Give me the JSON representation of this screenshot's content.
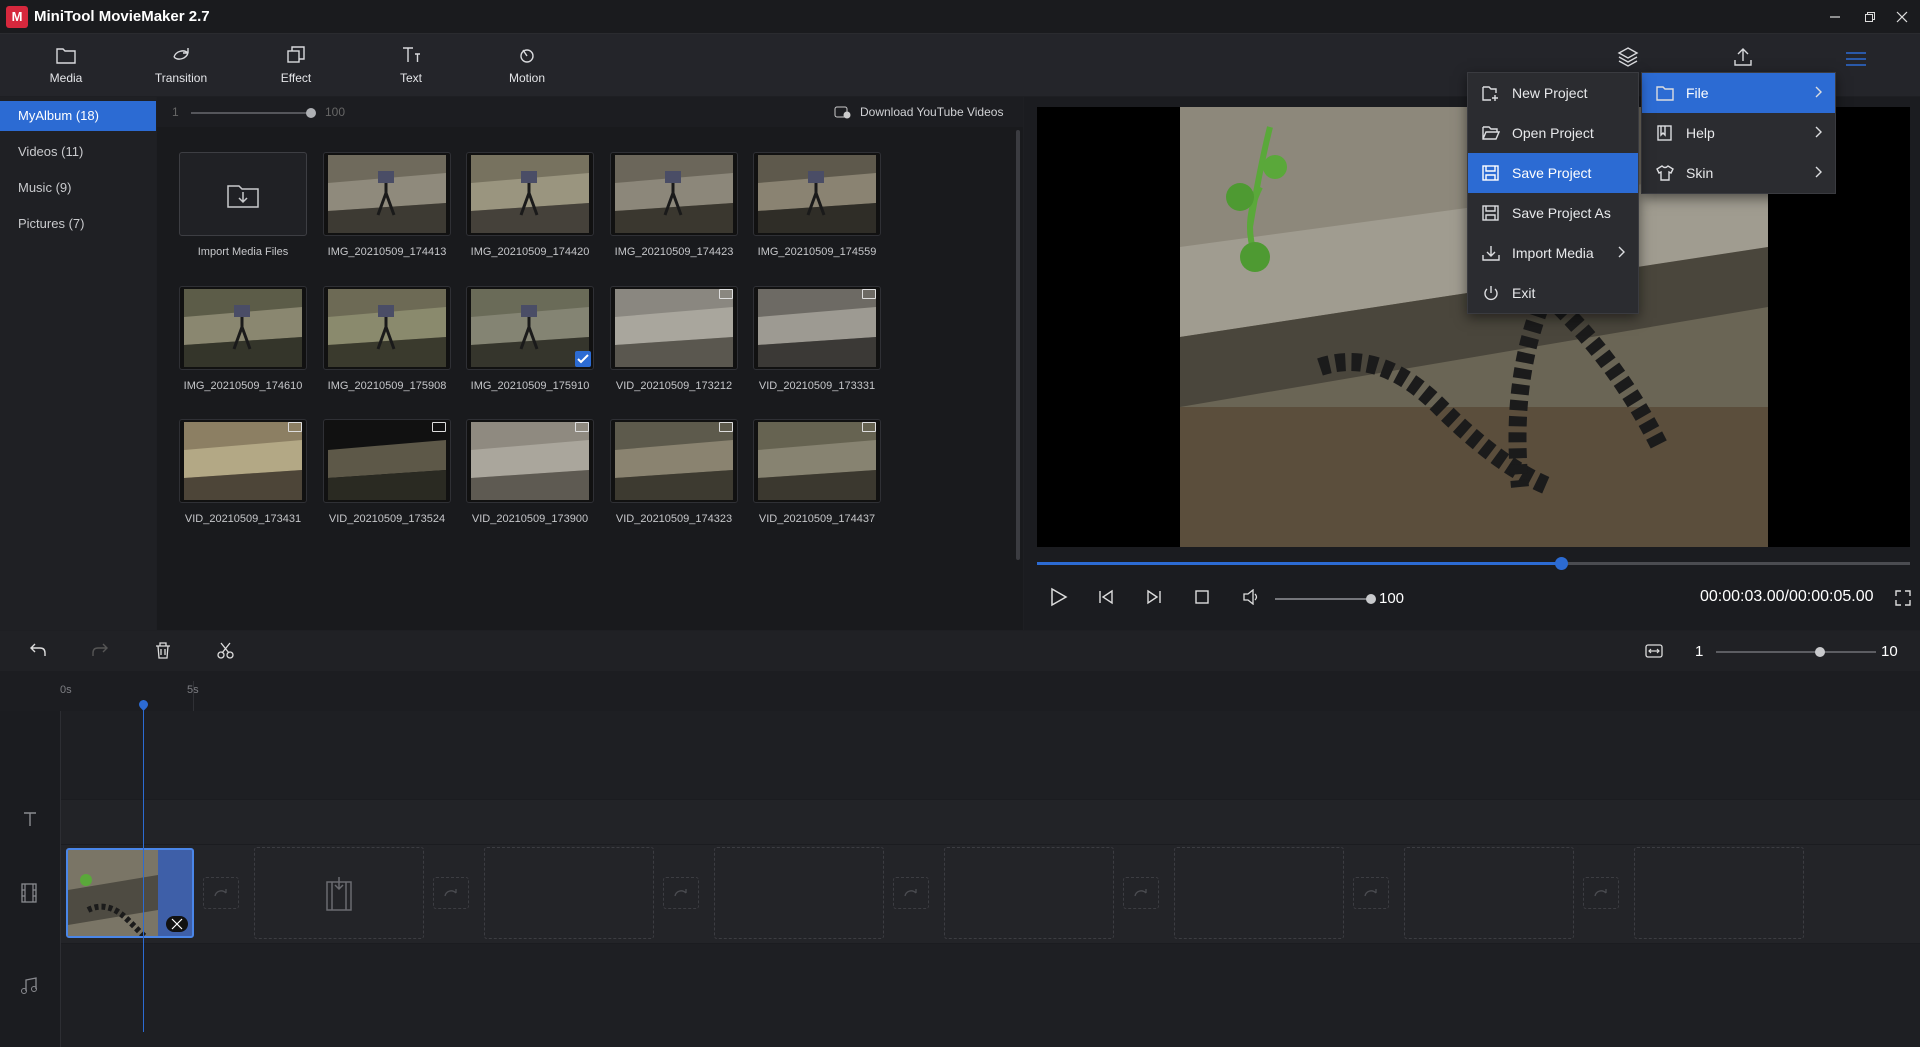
{
  "window": {
    "title": "MiniTool MovieMaker 2.7",
    "logo": "M"
  },
  "toolbar": {
    "items": [
      {
        "label": "Media",
        "icon": "folder-icon"
      },
      {
        "label": "Transition",
        "icon": "transition-icon"
      },
      {
        "label": "Effect",
        "icon": "effect-icon"
      },
      {
        "label": "Text",
        "icon": "text-icon"
      },
      {
        "label": "Motion",
        "icon": "motion-icon"
      }
    ]
  },
  "sidebar": {
    "items": [
      {
        "label": "MyAlbum",
        "count": "(18)"
      },
      {
        "label": "Videos",
        "count": "(11)"
      },
      {
        "label": "Music",
        "count": "(9)"
      },
      {
        "label": "Pictures",
        "count": "(7)"
      }
    ]
  },
  "media": {
    "zoom_min": "1",
    "zoom_max": "100",
    "zoom_level": 1.0,
    "download_label": "Download YouTube Videos",
    "import_label": "Import Media Files",
    "items": [
      "IMG_20210509_174413",
      "IMG_20210509_174420",
      "IMG_20210509_174423",
      "IMG_20210509_174559",
      "IMG_20210509_174610",
      "IMG_20210509_175908",
      "IMG_20210509_175910",
      "VID_20210509_173212",
      "VID_20210509_173331",
      "VID_20210509_173431",
      "VID_20210509_173524",
      "VID_20210509_173900",
      "VID_20210509_174323",
      "VID_20210509_174437"
    ]
  },
  "player": {
    "progress": 0.6,
    "volume": "100",
    "volume_level": 1.0,
    "time": "00:00:03.00/00:00:05.00"
  },
  "timeline": {
    "zoom_min": "1",
    "zoom_max": "10",
    "zoom_level": 0.65,
    "ruler": [
      "0s",
      "5s"
    ]
  },
  "main_menu": {
    "items": [
      {
        "label": "File",
        "icon": "folder-icon"
      },
      {
        "label": "Help",
        "icon": "help-book-icon"
      },
      {
        "label": "Skin",
        "icon": "shirt-icon"
      }
    ]
  },
  "file_menu": {
    "items": [
      {
        "label": "New Project",
        "icon": "new-project-icon"
      },
      {
        "label": "Open Project",
        "icon": "open-folder-icon"
      },
      {
        "label": "Save Project",
        "icon": "save-icon"
      },
      {
        "label": "Save Project As",
        "icon": "save-as-icon"
      },
      {
        "label": "Import Media",
        "icon": "import-icon"
      },
      {
        "label": "Exit",
        "icon": "power-icon"
      }
    ]
  },
  "colors": {
    "accent": "#2c6bd3",
    "brand": "#d6283d",
    "background": "#1e1f23"
  }
}
